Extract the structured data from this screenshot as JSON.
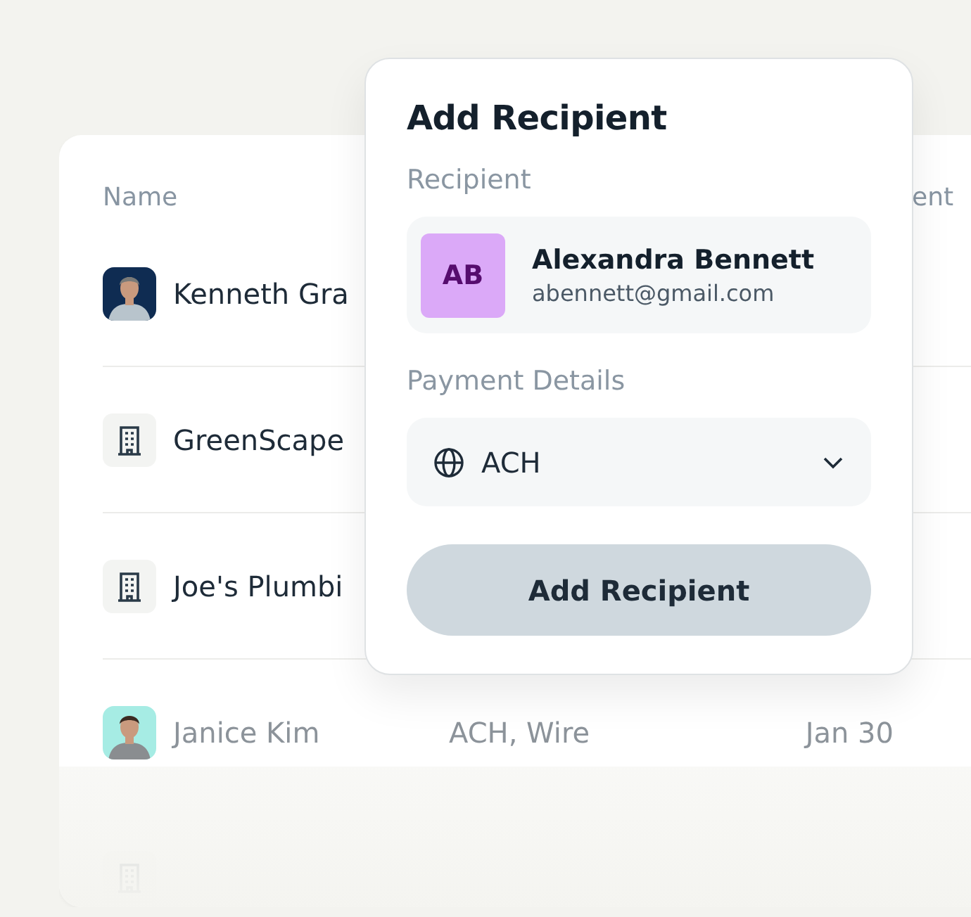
{
  "table": {
    "columns": [
      "Name",
      "ent"
    ],
    "rows": [
      {
        "kind": "person",
        "name": "Kenneth Gra",
        "dimmed": false
      },
      {
        "kind": "business",
        "name": "GreenScape",
        "dimmed": false
      },
      {
        "kind": "business",
        "name": "Joe's Plumbi",
        "dimmed": false
      },
      {
        "kind": "person",
        "name": "Janice Kim",
        "payment_methods": "ACH, Wire",
        "date": "Jan 30",
        "dimmed": true
      },
      {
        "kind": "business",
        "dimmed": true
      }
    ]
  },
  "dialog": {
    "title": "Add Recipient",
    "recipient_label": "Recipient",
    "recipient": {
      "initials": "AB",
      "name": "Alexandra Bennett",
      "email": "abennett@gmail.com"
    },
    "payment_label": "Payment Details",
    "payment_method": {
      "value": "ACH"
    },
    "button": {
      "label": "Add Recipient",
      "disabled": true
    }
  }
}
